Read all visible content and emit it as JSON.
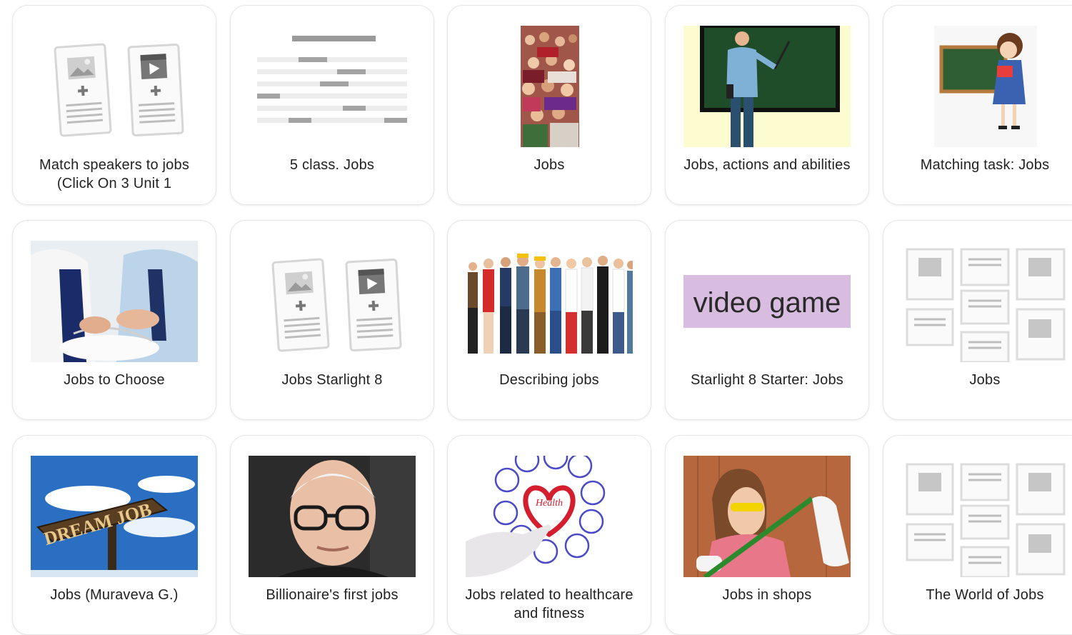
{
  "cards": [
    {
      "title": "Match speakers to jobs (Click On 3 Unit 1",
      "thumb": "placeholder-media-icon"
    },
    {
      "title": "5 class. Jobs",
      "thumb": "placeholder-text-lines-icon"
    },
    {
      "title": "Jobs",
      "thumb": "crowd-photo"
    },
    {
      "title": "Jobs, actions and abilities",
      "thumb": "teacher-blackboard-illustration"
    },
    {
      "title": "Matching task: Jobs",
      "thumb": "girl-teacher-illustration"
    },
    {
      "title": "Jobs to Choose",
      "thumb": "business-meeting-photo"
    },
    {
      "title": "Jobs Starlight 8",
      "thumb": "placeholder-media-icon"
    },
    {
      "title": "Describing jobs",
      "thumb": "workers-group-photo"
    },
    {
      "title": "Starlight 8 Starter: Jobs",
      "thumb": "video-game-text-image",
      "thumb_text": "video game"
    },
    {
      "title": "Jobs",
      "thumb": "placeholder-grid-icon"
    },
    {
      "title": "Jobs (Muraveva G.)",
      "thumb": "dream-job-sign-photo",
      "thumb_text": "DREAM JOB"
    },
    {
      "title": "Billionaire's first jobs",
      "thumb": "elderly-man-photo"
    },
    {
      "title": "Jobs related to healthcare and fitness",
      "thumb": "health-diagram-image",
      "thumb_text": "Health"
    },
    {
      "title": "Jobs in shops",
      "thumb": "girl-with-mop-photo"
    },
    {
      "title": "The World of Jobs",
      "thumb": "placeholder-grid-icon"
    }
  ]
}
